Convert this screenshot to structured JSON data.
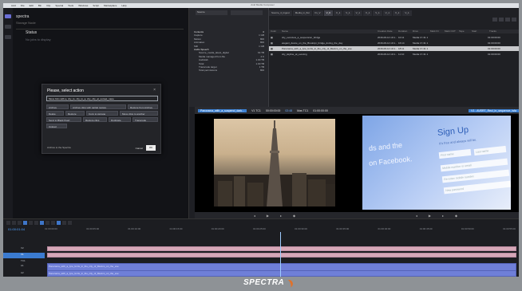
{
  "window": {
    "title": "Avid Media Composer"
  },
  "menubar": [
    "Avid",
    "File",
    "Edit",
    "Bin",
    "Clip",
    "Special",
    "Tools",
    "Windows",
    "Script",
    "Marketplace",
    "Help"
  ],
  "left_panel": {
    "title": "spectra",
    "subtitle": "Storage Node",
    "status_label": "Status",
    "status_value": "No jobs to display"
  },
  "dialog": {
    "title": "Please, select action",
    "input_text": "Move bins with a, city_to, city_to_a, city_city_at_sunset_nane",
    "tags": [
      "Archive",
      "Archive clips with partial restore",
      "Restore from Archive",
      "Delete",
      "Restore",
      "Copy to storage",
      "Move clips to another",
      "Send to Black Pearl",
      "Restore clips",
      "Duplicate",
      "Transcode",
      "Upload"
    ],
    "footer_label": "Archive to the Spectra",
    "cancel_label": "Cancel",
    "ok_label": "OK"
  },
  "bin": {
    "selector": "Source",
    "items": [
      {
        "name": "Contents",
        "value": "0"
      },
      {
        "name": "Capture",
        "value": "1 GB"
      },
      {
        "name": "Motion",
        "value": "800"
      },
      {
        "name": "Animation",
        "value": "800"
      },
      {
        "name": "Still",
        "value": "1 GB"
      },
      {
        "name": "Audio Speech",
        "value": ""
      },
      {
        "name": "Source_media_latest_digital",
        "value": "64 TB"
      },
      {
        "name": "Media managed from file",
        "value": "4 K"
      },
      {
        "name": "Audiolab",
        "value": "1.00 TB"
      },
      {
        "name": "Total",
        "value": "1.00 TB"
      },
      {
        "name": "Transcode target",
        "value": "1 TB"
      },
      {
        "name": "Total permissions",
        "value": "800"
      }
    ]
  },
  "clips": {
    "tabs": [
      "Source_4_Ingest",
      "Media_in_flat",
      "Fx_V",
      "V_6",
      "V_1",
      "V_1",
      "V_1",
      "V_1",
      "V_1",
      "V_1",
      "V_1",
      "V_1"
    ],
    "active_tab": 3,
    "columns": [
      "Color",
      "Name",
      "",
      "",
      "Creation Date",
      "Duration",
      "Drive",
      "Mark IN",
      "Mark OUT",
      "Tape",
      "Start",
      "Tracks"
    ],
    "rows": [
      {
        "name": "city_overview_a_suspension_bridge",
        "date": "2016-06-14 10:1...",
        "duration": "10:11",
        "drive": "Media 17-31 1",
        "start": "01:00:00:00",
        "selected": false
      },
      {
        "name": "elegant_dance_on_the_Brooklyn_bridge_during_the_day",
        "date": "2016-06-14 10:1...",
        "duration": "16:14",
        "drive": "Media 17-31 1",
        "start": "01:00:00:00",
        "selected": false
      },
      {
        "name": "Panorama_with_a_lyre_ferris_in_the_city_of_Mexico_on_the_eve",
        "date": "2016-06-14 10:1...",
        "duration": "18:11",
        "drive": "Media 17-31 1",
        "start": "01:00:00:00",
        "selected": true
      },
      {
        "name": "city_skyline_at_evening",
        "date": "2016-06-14 10:1...",
        "duration": "11:10",
        "drive": "Media 17-31 1",
        "start": "01:00:00:00",
        "selected": false
      }
    ]
  },
  "monitors": {
    "source_label": "Panorama_with_a_suspend_dark...",
    "source_track": "V1 TC1",
    "source_tc": "00:00:00:00",
    "source_mas": "02:48",
    "source_mas_label": "Mas TC1",
    "source_mas_tc": "01:00:00:00",
    "record_label": "V1 - AVERT_Recl_in_sequence_tsfa",
    "signup_title": "Sign Up",
    "signup_sub": "It's free and always will be.",
    "fb_line1": "ds and the",
    "fb_line2": "on Facebook.",
    "field_first": "First name",
    "field_last": "Last name",
    "field_mobile": "Mobile number or email",
    "field_reenter": "Re-enter mobile number",
    "field_password": "New password"
  },
  "timeline": {
    "timecode": "01:00:01:04",
    "ruler": [
      "01:00:00:00",
      "01:00:05:00",
      "01:00:10:00",
      "01:00:15:00",
      "01:00:20:00",
      "01:00:25:00",
      "01:00:30:00",
      "01:00:35:00",
      "01:00:40:00",
      "01:00:45:00",
      "01:00:50:00",
      "01:00:55:00"
    ],
    "tracks": [
      "V2",
      "V1",
      "TC1",
      "A1",
      "A2"
    ],
    "audio_clip_label": "Panorama_with_a_lyre_ferris_in_the_city_of_Mexico_on_the_eve"
  },
  "brand": "SPECTRA"
}
